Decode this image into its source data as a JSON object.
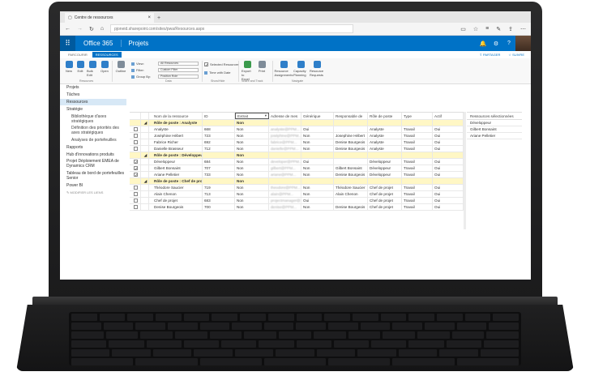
{
  "browser": {
    "tab_title": "Centre de ressources",
    "url": "pjoneid.sharepoint.com/sites/pwa/Resources.aspx"
  },
  "o365": {
    "suite_title": "Office 365",
    "app_title": "Projets"
  },
  "ribbon": {
    "tabs": [
      "PARCOURIR",
      "RESSOURCES"
    ],
    "right_actions": [
      "PARTAGER",
      "SUIVRE"
    ],
    "buttons": [
      "New",
      "Edit",
      "Bulk Edit",
      "Open",
      "Outline",
      "Export to Excel",
      "Print",
      "Resource Assignments",
      "Capacity Planning",
      "Resource Requests"
    ],
    "small": [
      "View:",
      "Filter:",
      "Group By:",
      "Selected Resources",
      "Time with Date"
    ],
    "dropdowns": [
      "All Resources",
      "Custom Filter",
      "Position Role"
    ],
    "groups": [
      "Resources",
      "Data",
      "Show/Hide",
      "Share and Track",
      "Navigate"
    ]
  },
  "leftnav": [
    {
      "label": "Projets",
      "type": "item"
    },
    {
      "label": "Tâches",
      "type": "item"
    },
    {
      "label": "Ressources",
      "type": "active"
    },
    {
      "label": "Stratégie",
      "type": "item"
    },
    {
      "label": "Bibliothèque d'axes stratégiques",
      "type": "sub"
    },
    {
      "label": "Définition des priorités des axes stratégiques",
      "type": "sub"
    },
    {
      "label": "Analyses de portefeuilles",
      "type": "sub"
    },
    {
      "label": "Rapports",
      "type": "item"
    },
    {
      "label": "Hub d'innovations produits",
      "type": "item"
    },
    {
      "label": "Projet Déploiement EMEA de Dynamics CRM",
      "type": "item"
    },
    {
      "label": "Tableau de bord de portefeuilles Senior",
      "type": "item"
    },
    {
      "label": "Power BI",
      "type": "item"
    },
    {
      "label": "✎ MODIFIER LES LIENS",
      "type": "link"
    }
  ],
  "grid": {
    "headers": [
      "Nom de la ressource",
      "ID",
      "Extrait",
      "Adresse de mes",
      "Générique",
      "Responsable de",
      "Rôle de poste",
      "Type",
      "Actif"
    ],
    "rows": [
      {
        "kind": "group",
        "checked": false,
        "name": "Rôle de poste : Analyste",
        "id": "",
        "ext": "Non",
        "mail": "",
        "gen": "",
        "resp": "",
        "role": "",
        "type": "",
        "act": ""
      },
      {
        "kind": "row",
        "checked": false,
        "name": "Analyste",
        "id": "668",
        "ext": "Non",
        "mail": "analyste@PPM...",
        "gen": "Oui",
        "resp": "",
        "role": "Analyste",
        "type": "Travail",
        "act": "Oui"
      },
      {
        "kind": "row",
        "checked": false,
        "name": "Joséphine Hébert",
        "id": "723",
        "ext": "Non",
        "mail": "joséphine@PPM...",
        "gen": "Non",
        "resp": "Josephine Hébert",
        "role": "Analyste",
        "type": "Travail",
        "act": "Oui"
      },
      {
        "kind": "row",
        "checked": false,
        "name": "Fabrice Richer",
        "id": "692",
        "ext": "Non",
        "mail": "fabrice@PPM...",
        "gen": "Non",
        "resp": "Denise Bourgeois",
        "role": "Analyste",
        "type": "Travail",
        "act": "Oui"
      },
      {
        "kind": "row",
        "checked": false,
        "name": "Danielle Brasseur",
        "id": "712",
        "ext": "Non",
        "mail": "danielle@PPM...",
        "gen": "Non",
        "resp": "Denise Bourgeois",
        "role": "Analyste",
        "type": "Travail",
        "act": "Oui"
      },
      {
        "kind": "group",
        "checked": false,
        "name": "Rôle de poste : Développeur",
        "id": "",
        "ext": "Non",
        "mail": "",
        "gen": "",
        "resp": "",
        "role": "",
        "type": "",
        "act": ""
      },
      {
        "kind": "row",
        "checked": true,
        "name": "Développeur",
        "id": "684",
        "ext": "Non",
        "mail": "developer@PPM...",
        "gen": "Oui",
        "resp": "",
        "role": "Développeur",
        "type": "Travail",
        "act": "Oui"
      },
      {
        "kind": "row",
        "checked": true,
        "name": "Gilbert Bonsaint",
        "id": "707",
        "ext": "Non",
        "mail": "gilbert@PPM...",
        "gen": "Non",
        "resp": "Gilbert Bonsaint",
        "role": "Développeur",
        "type": "Travail",
        "act": "Oui"
      },
      {
        "kind": "row",
        "checked": true,
        "name": "Ariane Pelletier",
        "id": "733",
        "ext": "Non",
        "mail": "ariane@PPM...",
        "gen": "Non",
        "resp": "Denise Bourgeois",
        "role": "Développeur",
        "type": "Travail",
        "act": "Oui"
      },
      {
        "kind": "group",
        "checked": false,
        "name": "Rôle de poste : Chef de projet",
        "id": "",
        "ext": "Non",
        "mail": "",
        "gen": "",
        "resp": "",
        "role": "",
        "type": "",
        "act": ""
      },
      {
        "kind": "row",
        "checked": false,
        "name": "Théodore Saucier",
        "id": "719",
        "ext": "Non",
        "mail": "theodore@PPM...",
        "gen": "Non",
        "resp": "Théodore Saucier",
        "role": "Chef de projet",
        "type": "Travail",
        "act": "Oui"
      },
      {
        "kind": "row",
        "checked": false,
        "name": "Alain Chenon",
        "id": "713",
        "ext": "Non",
        "mail": "alain@PPM...",
        "gen": "Non",
        "resp": "Alain Chenon",
        "role": "Chef de projet",
        "type": "Travail",
        "act": "Oui"
      },
      {
        "kind": "row",
        "checked": false,
        "name": "Chef de projet",
        "id": "683",
        "ext": "Non",
        "mail": "projectmanager@...",
        "gen": "Oui",
        "resp": "",
        "role": "Chef de projet",
        "type": "Travail",
        "act": "Oui"
      },
      {
        "kind": "row",
        "checked": false,
        "name": "Denise Bourgeois",
        "id": "700",
        "ext": "Non",
        "mail": "denise@PPM...",
        "gen": "Non",
        "resp": "Denise Bourgeois",
        "role": "Chef de projet",
        "type": "Travail",
        "act": "Oui"
      }
    ]
  },
  "selected_pane": {
    "header": "Ressources sélectionnées",
    "items": [
      "Développeur",
      "Gilbert Bonsaint",
      "Ariane Pelletier"
    ]
  },
  "colors": {
    "o365_blue": "#0072c6",
    "group_row": "#fff7c5",
    "active_nav": "#d7e8f6"
  }
}
